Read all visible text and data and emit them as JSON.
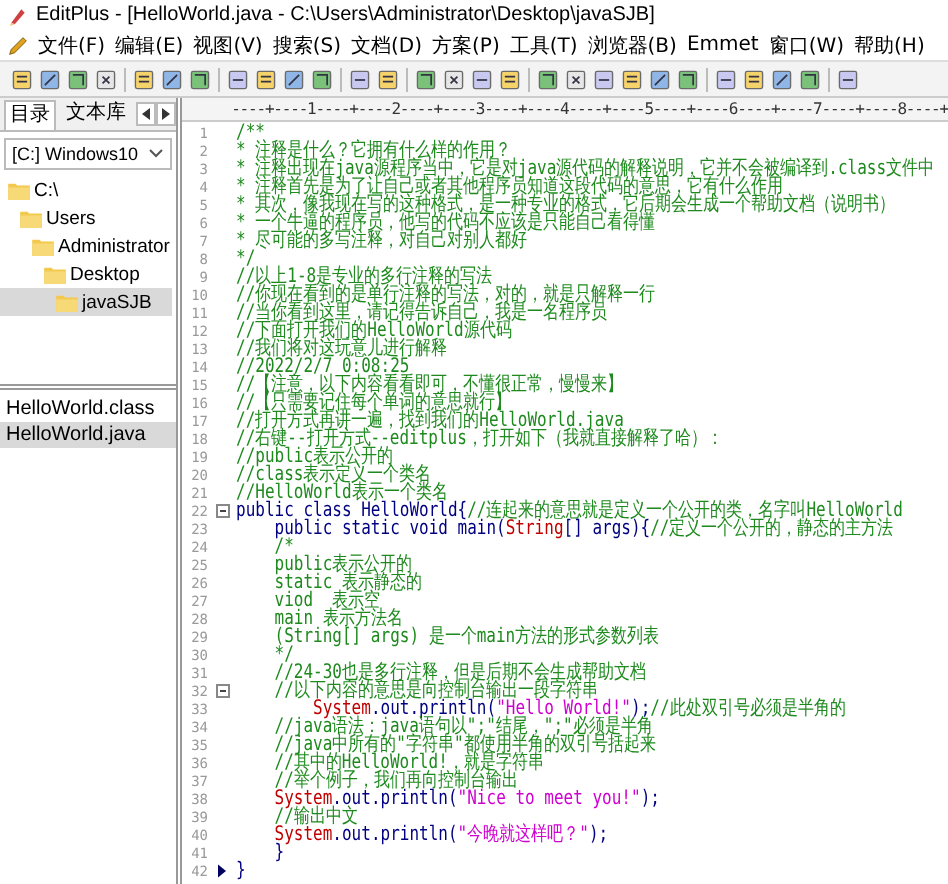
{
  "window": {
    "title": "EditPlus - [HelloWorld.java - C:\\Users\\Administrator\\Desktop\\javaSJB]"
  },
  "menu": [
    "文件(F)",
    "编辑(E)",
    "视图(V)",
    "搜索(S)",
    "文档(D)",
    "方案(P)",
    "工具(T)",
    "浏览器(B)",
    "Emmet",
    "窗口(W)",
    "帮助(H)"
  ],
  "sidebar": {
    "tabs": [
      {
        "label": "目录",
        "selected": true
      },
      {
        "label": "文本库",
        "selected": false
      }
    ],
    "drive": "[C:] Windows10",
    "folders": [
      {
        "name": "C:\\",
        "selected": false,
        "children": [
          {
            "name": "Users",
            "selected": false,
            "children": [
              {
                "name": "Administrator",
                "selected": false,
                "children": [
                  {
                    "name": "Desktop",
                    "selected": false,
                    "children": [
                      {
                        "name": "javaSJB",
                        "selected": true
                      }
                    ]
                  }
                ]
              }
            ]
          }
        ]
      }
    ],
    "files": [
      {
        "name": "HelloWorld.class",
        "selected": false
      },
      {
        "name": "HelloWorld.java",
        "selected": true
      }
    ]
  },
  "editor": {
    "ruler": "----+----1----+----2----+----3----+----4----+----5----+----6----+----7----+----8----+",
    "lines": [
      {
        "number": "1",
        "parts": [
          {
            "kind": "comment",
            "text": "/**"
          }
        ]
      },
      {
        "number": "2",
        "parts": [
          {
            "kind": "comment",
            "text": "* 注释是什么？它拥有什么样的作用？"
          }
        ]
      },
      {
        "number": "3",
        "parts": [
          {
            "kind": "comment",
            "text": "* 注释出现在java源程序当中，它是对java源代码的解释说明，它并不会被编译到.class文件中"
          }
        ]
      },
      {
        "number": "4",
        "parts": [
          {
            "kind": "comment",
            "text": "* 注释首先是为了让自己或者其他程序员知道这段代码的意思，它有什么作用"
          }
        ]
      },
      {
        "number": "5",
        "parts": [
          {
            "kind": "comment",
            "text": "* 其次，像我现在写的这种格式，是一种专业的格式，它后期会生成一个帮助文档（说明书）"
          }
        ]
      },
      {
        "number": "6",
        "parts": [
          {
            "kind": "comment",
            "text": "* 一个牛逼的程序员，他写的代码不应该是只能自己看得懂"
          }
        ]
      },
      {
        "number": "7",
        "parts": [
          {
            "kind": "comment",
            "text": "* 尽可能的多写注释，对自己对别人都好"
          }
        ]
      },
      {
        "number": "8",
        "parts": [
          {
            "kind": "comment",
            "text": "*/"
          }
        ]
      },
      {
        "number": "9",
        "parts": [
          {
            "kind": "comment",
            "text": "//以上1-8是专业的多行注释的写法"
          }
        ]
      },
      {
        "number": "10",
        "parts": [
          {
            "kind": "comment",
            "text": "//你现在看到的是单行注释的写法，对的，就是只解释一行"
          }
        ]
      },
      {
        "number": "11",
        "parts": [
          {
            "kind": "comment",
            "text": "//当你看到这里，请记得告诉自己，我是一名程序员"
          }
        ]
      },
      {
        "number": "12",
        "parts": [
          {
            "kind": "comment",
            "text": "//下面打开我们的HelloWorld源代码"
          }
        ]
      },
      {
        "number": "13",
        "parts": [
          {
            "kind": "comment",
            "text": "//我们将对这玩意儿进行解释"
          }
        ]
      },
      {
        "number": "14",
        "parts": [
          {
            "kind": "comment",
            "text": "//2022/2/7 0:08:25"
          }
        ]
      },
      {
        "number": "15",
        "parts": [
          {
            "kind": "comment",
            "text": "//【注意，以下内容看看即可，不懂很正常，慢慢来】"
          }
        ]
      },
      {
        "number": "16",
        "parts": [
          {
            "kind": "comment",
            "text": "//【只需要记住每个单词的意思就行】"
          }
        ]
      },
      {
        "number": "17",
        "parts": [
          {
            "kind": "comment",
            "text": "//打开方式再讲一遍，找到我们的HelloWorld.java"
          }
        ]
      },
      {
        "number": "18",
        "parts": [
          {
            "kind": "comment",
            "text": "//右键--打开方式--editplus，打开如下（我就直接解释了哈）："
          }
        ]
      },
      {
        "number": "19",
        "parts": [
          {
            "kind": "comment",
            "text": "//public表示公开的"
          }
        ]
      },
      {
        "number": "20",
        "parts": [
          {
            "kind": "comment",
            "text": "//class表示定义一个类名"
          }
        ]
      },
      {
        "number": "21",
        "parts": [
          {
            "kind": "comment",
            "text": "//HelloWorld表示一个类名"
          }
        ]
      },
      {
        "number": "22",
        "fold": true,
        "parts": [
          {
            "kind": "code",
            "text": "public class HelloWorld{"
          },
          {
            "kind": "comment",
            "text": "//连起来的意思就是定义一个公开的类，名字叫HelloWorld"
          }
        ]
      },
      {
        "number": "23",
        "parts": [
          {
            "kind": "code",
            "text": "    public static void main("
          },
          {
            "kind": "type",
            "text": "String"
          },
          {
            "kind": "code",
            "text": "[] args){"
          },
          {
            "kind": "comment",
            "text": "//定义一个公开的，静态的主方法"
          }
        ]
      },
      {
        "number": "24",
        "parts": [
          {
            "kind": "comment",
            "text": "    /*"
          }
        ]
      },
      {
        "number": "25",
        "parts": [
          {
            "kind": "comment",
            "text": "    public表示公开的"
          }
        ]
      },
      {
        "number": "26",
        "parts": [
          {
            "kind": "comment",
            "text": "    static 表示静态的"
          }
        ]
      },
      {
        "number": "27",
        "parts": [
          {
            "kind": "comment",
            "text": "    viod  表示空"
          }
        ]
      },
      {
        "number": "28",
        "parts": [
          {
            "kind": "comment",
            "text": "    main 表示方法名"
          }
        ]
      },
      {
        "number": "29",
        "parts": [
          {
            "kind": "comment",
            "text": "    (String[] args) 是一个main方法的形式参数列表"
          }
        ]
      },
      {
        "number": "30",
        "parts": [
          {
            "kind": "comment",
            "text": "    */"
          }
        ]
      },
      {
        "number": "31",
        "parts": [
          {
            "kind": "comment",
            "text": "    //24-30也是多行注释，但是后期不会生成帮助文档"
          }
        ]
      },
      {
        "number": "32",
        "fold": true,
        "parts": [
          {
            "kind": "comment",
            "text": "    //以下内容的意思是向控制台输出一段字符串"
          }
        ]
      },
      {
        "number": "33",
        "parts": [
          {
            "kind": "type",
            "text": "        System"
          },
          {
            "kind": "code",
            "text": ".out.println("
          },
          {
            "kind": "string",
            "text": "\"Hello World!\""
          },
          {
            "kind": "code",
            "text": ");"
          },
          {
            "kind": "comment",
            "text": "//此处双引号必须是半角的"
          }
        ]
      },
      {
        "number": "34",
        "parts": [
          {
            "kind": "comment",
            "text": "    //java语法：java语句以\";\"结尾，\";\"必须是半角"
          }
        ]
      },
      {
        "number": "35",
        "parts": [
          {
            "kind": "comment",
            "text": "    //java中所有的\"字符串\"都使用半角的双引号括起来"
          }
        ]
      },
      {
        "number": "36",
        "parts": [
          {
            "kind": "comment",
            "text": "    //其中的HelloWorld!，就是字符串"
          }
        ]
      },
      {
        "number": "37",
        "parts": [
          {
            "kind": "comment",
            "text": "    //举个例子，我们再向控制台输出"
          }
        ]
      },
      {
        "number": "38",
        "parts": [
          {
            "kind": "type",
            "text": "    System"
          },
          {
            "kind": "code",
            "text": ".out.println("
          },
          {
            "kind": "string",
            "text": "\"Nice to meet you!\""
          },
          {
            "kind": "code",
            "text": ");"
          }
        ]
      },
      {
        "number": "39",
        "parts": [
          {
            "kind": "comment",
            "text": "    //输出中文"
          }
        ]
      },
      {
        "number": "40",
        "parts": [
          {
            "kind": "type",
            "text": "    System"
          },
          {
            "kind": "code",
            "text": ".out.println("
          },
          {
            "kind": "string",
            "text": "\"今晚就这样吧？\""
          },
          {
            "kind": "code",
            "text": ");"
          }
        ]
      },
      {
        "number": "41",
        "parts": [
          {
            "kind": "code",
            "text": "    }"
          }
        ]
      },
      {
        "number": "42",
        "current": true,
        "parts": [
          {
            "kind": "code",
            "text": "}"
          }
        ]
      }
    ]
  }
}
